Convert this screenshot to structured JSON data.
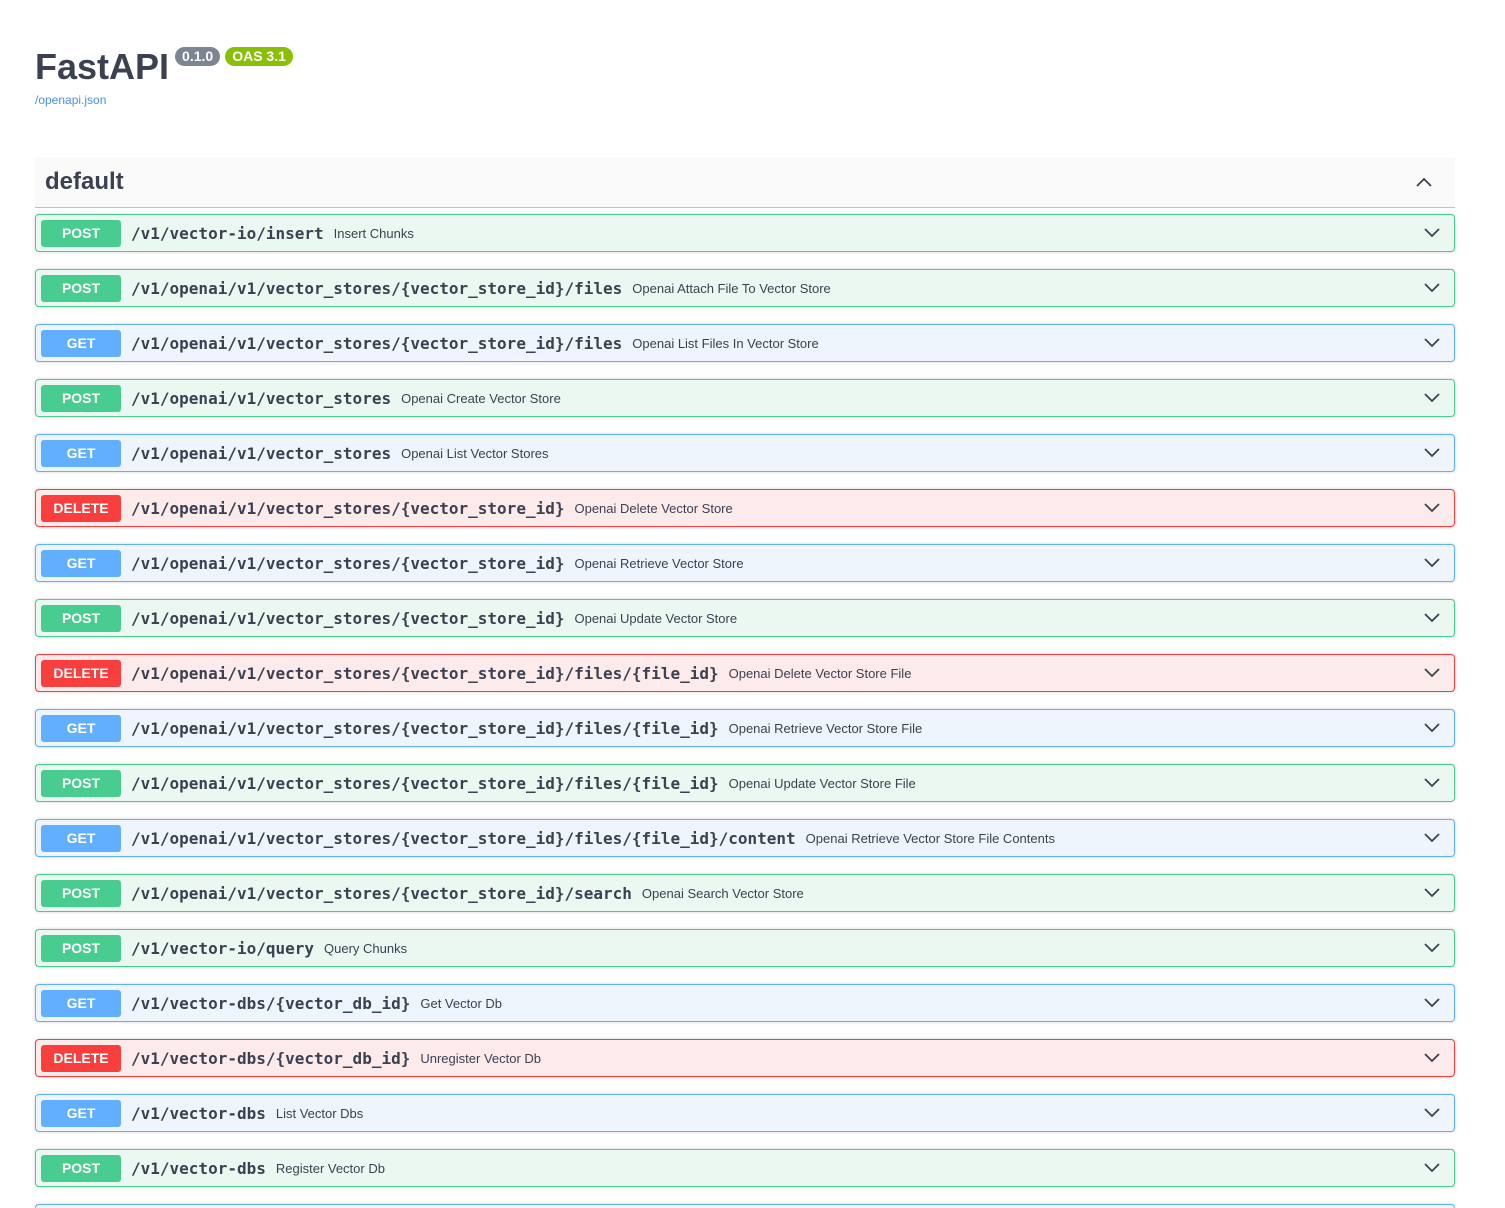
{
  "info": {
    "title": "FastAPI",
    "version": "0.1.0",
    "oas": "OAS 3.1",
    "spec_link": "/openapi.json"
  },
  "tag": {
    "name": "default",
    "toggle_icon": "chevron-up-icon"
  },
  "colors": {
    "post": "#49cc90",
    "get": "#61affe",
    "delete": "#f93e3e"
  },
  "operations": [
    {
      "method": "POST",
      "path": "/v1/vector-io/insert",
      "summary": "Insert Chunks"
    },
    {
      "method": "POST",
      "path": "/v1/openai/v1/vector_stores/{vector_store_id}/files",
      "summary": "Openai Attach File To Vector Store"
    },
    {
      "method": "GET",
      "path": "/v1/openai/v1/vector_stores/{vector_store_id}/files",
      "summary": "Openai List Files In Vector Store"
    },
    {
      "method": "POST",
      "path": "/v1/openai/v1/vector_stores",
      "summary": "Openai Create Vector Store"
    },
    {
      "method": "GET",
      "path": "/v1/openai/v1/vector_stores",
      "summary": "Openai List Vector Stores"
    },
    {
      "method": "DELETE",
      "path": "/v1/openai/v1/vector_stores/{vector_store_id}",
      "summary": "Openai Delete Vector Store"
    },
    {
      "method": "GET",
      "path": "/v1/openai/v1/vector_stores/{vector_store_id}",
      "summary": "Openai Retrieve Vector Store"
    },
    {
      "method": "POST",
      "path": "/v1/openai/v1/vector_stores/{vector_store_id}",
      "summary": "Openai Update Vector Store"
    },
    {
      "method": "DELETE",
      "path": "/v1/openai/v1/vector_stores/{vector_store_id}/files/{file_id}",
      "summary": "Openai Delete Vector Store File"
    },
    {
      "method": "GET",
      "path": "/v1/openai/v1/vector_stores/{vector_store_id}/files/{file_id}",
      "summary": "Openai Retrieve Vector Store File"
    },
    {
      "method": "POST",
      "path": "/v1/openai/v1/vector_stores/{vector_store_id}/files/{file_id}",
      "summary": "Openai Update Vector Store File"
    },
    {
      "method": "GET",
      "path": "/v1/openai/v1/vector_stores/{vector_store_id}/files/{file_id}/content",
      "summary": "Openai Retrieve Vector Store File Contents"
    },
    {
      "method": "POST",
      "path": "/v1/openai/v1/vector_stores/{vector_store_id}/search",
      "summary": "Openai Search Vector Store"
    },
    {
      "method": "POST",
      "path": "/v1/vector-io/query",
      "summary": "Query Chunks"
    },
    {
      "method": "GET",
      "path": "/v1/vector-dbs/{vector_db_id}",
      "summary": "Get Vector Db"
    },
    {
      "method": "DELETE",
      "path": "/v1/vector-dbs/{vector_db_id}",
      "summary": "Unregister Vector Db"
    },
    {
      "method": "GET",
      "path": "/v1/vector-dbs",
      "summary": "List Vector Dbs"
    },
    {
      "method": "POST",
      "path": "/v1/vector-dbs",
      "summary": "Register Vector Db"
    }
  ]
}
